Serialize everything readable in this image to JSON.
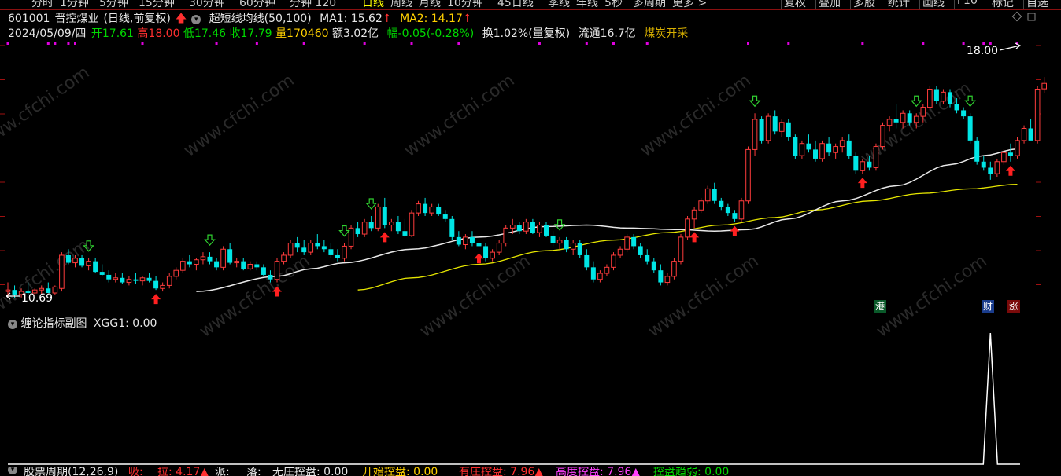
{
  "toolbar": {
    "periods": [
      {
        "label": "分时",
        "active": false
      },
      {
        "label": "1分钟",
        "active": false
      },
      {
        "label": "5分钟",
        "active": false
      },
      {
        "label": "15分钟",
        "active": false
      },
      {
        "label": "30分钟",
        "active": false
      },
      {
        "label": "60分钟",
        "active": false
      },
      {
        "label": "分钟 120",
        "active": false
      },
      {
        "label": "日线",
        "active": true
      },
      {
        "label": "周线",
        "active": false
      },
      {
        "label": "月线",
        "active": false
      },
      {
        "label": "10分钟",
        "active": false
      },
      {
        "label": "45日线",
        "active": false
      },
      {
        "label": "季线",
        "active": false
      },
      {
        "label": "年线",
        "active": false
      },
      {
        "label": "5秒",
        "active": false
      },
      {
        "label": "多周期",
        "active": false
      },
      {
        "label": "更多 >",
        "active": false
      }
    ],
    "right_menu": [
      "复权",
      "叠加",
      "多股",
      "统计",
      "画线",
      "F10",
      "标记",
      "自选"
    ]
  },
  "header": {
    "code": "601001",
    "name": "晋控煤业",
    "mode": "(日线,前复权)",
    "indicator": "超短线均线(50,100)",
    "ma1_label": "MA1: 15.62",
    "ma2_label": "MA2: 14.17",
    "date": "2024/05/09/四",
    "open": "开17.61",
    "high": "高18.00",
    "low": "低17.46",
    "close": "收17.79",
    "volume": "量170460",
    "amount": "额3.02亿",
    "change": "幅-0.05(-0.28%)",
    "turnover": "换1.02%(量复权)",
    "float": "流通16.7亿",
    "sector": "煤炭开采"
  },
  "price_labels": {
    "high_mark": "18.00",
    "low_mark": "10.69"
  },
  "event_tags": {
    "gang": "港",
    "cai": "财",
    "zhang": "涨"
  },
  "subchart": {
    "title": "缠论指标副图",
    "xgg1_label": "XGG1: 0.00"
  },
  "bottom": {
    "period_label": "股票周期(12,26,9)",
    "x": "吸:",
    "la": "拉: 4.17▲",
    "pai": "派:",
    "luo": "落:",
    "no_control": "无庄控盘: 0.00",
    "start_control": "开始控盘: 0.00",
    "has_control": "有庄控盘: 7.96▲",
    "high_control": "高度控盘: 7.96▲",
    "weak_control": "控盘趋弱: 0.00"
  },
  "watermark": "www.cfchi.com",
  "colors": {
    "up": "#ff3c3c",
    "down": "#00e6e6",
    "ma1": "#e8e8e8",
    "ma2": "#e6e600",
    "signal_up": "#ff2020",
    "signal_down": "#30d030",
    "background": "#000000"
  },
  "chart_data": {
    "type": "candlestick",
    "y_range": [
      10.2,
      19.2
    ],
    "ohlc": [
      [
        10.9,
        11.2,
        10.7,
        10.95
      ],
      [
        10.95,
        11.1,
        10.69,
        10.8
      ],
      [
        10.8,
        11.0,
        10.7,
        10.9
      ],
      [
        10.9,
        11.2,
        10.8,
        10.85
      ],
      [
        10.85,
        11.0,
        10.75,
        10.95
      ],
      [
        10.95,
        11.1,
        10.8,
        11.0
      ],
      [
        11.0,
        11.2,
        10.9,
        10.85
      ],
      [
        10.85,
        11.1,
        10.8,
        11.05
      ],
      [
        11.0,
        12.2,
        10.9,
        12.1
      ],
      [
        12.1,
        12.3,
        11.8,
        11.85
      ],
      [
        11.85,
        12.1,
        11.7,
        12.0
      ],
      [
        12.0,
        12.1,
        11.7,
        11.75
      ],
      [
        11.75,
        12.0,
        11.6,
        11.9
      ],
      [
        11.9,
        12.0,
        11.5,
        11.55
      ],
      [
        11.55,
        11.8,
        11.4,
        11.45
      ],
      [
        11.45,
        11.6,
        11.2,
        11.3
      ],
      [
        11.3,
        11.5,
        11.2,
        11.35
      ],
      [
        11.35,
        11.5,
        11.15,
        11.2
      ],
      [
        11.2,
        11.4,
        11.1,
        11.3
      ],
      [
        11.3,
        11.5,
        11.15,
        11.25
      ],
      [
        11.25,
        11.4,
        11.1,
        11.35
      ],
      [
        11.35,
        11.5,
        11.2,
        11.25
      ],
      [
        11.25,
        11.4,
        10.95,
        11.0
      ],
      [
        11.0,
        11.2,
        10.9,
        11.1
      ],
      [
        11.1,
        11.5,
        11.0,
        11.4
      ],
      [
        11.4,
        11.7,
        11.3,
        11.6
      ],
      [
        11.6,
        12.0,
        11.5,
        11.9
      ],
      [
        11.9,
        12.1,
        11.7,
        11.8
      ],
      [
        11.8,
        12.0,
        11.6,
        11.95
      ],
      [
        11.95,
        12.2,
        11.8,
        12.05
      ],
      [
        12.05,
        12.2,
        11.8,
        11.9
      ],
      [
        11.9,
        12.0,
        11.6,
        11.7
      ],
      [
        11.7,
        12.4,
        11.6,
        12.3
      ],
      [
        12.3,
        12.5,
        11.8,
        11.85
      ],
      [
        11.85,
        12.0,
        11.7,
        11.9
      ],
      [
        11.9,
        12.0,
        11.6,
        11.65
      ],
      [
        11.65,
        11.9,
        11.6,
        11.8
      ],
      [
        11.8,
        11.9,
        11.6,
        11.7
      ],
      [
        11.7,
        11.8,
        11.4,
        11.45
      ],
      [
        11.45,
        11.6,
        11.2,
        11.3
      ],
      [
        11.3,
        12.0,
        11.2,
        11.9
      ],
      [
        11.9,
        12.2,
        11.8,
        12.1
      ],
      [
        12.1,
        12.6,
        12.0,
        12.5
      ],
      [
        12.5,
        12.7,
        12.2,
        12.35
      ],
      [
        12.35,
        12.6,
        12.1,
        12.2
      ],
      [
        12.2,
        12.6,
        12.1,
        12.5
      ],
      [
        12.5,
        12.8,
        12.3,
        12.4
      ],
      [
        12.4,
        12.6,
        12.2,
        12.3
      ],
      [
        12.3,
        12.5,
        12.0,
        12.1
      ],
      [
        12.1,
        12.3,
        11.9,
        12.0
      ],
      [
        12.0,
        12.5,
        11.9,
        12.4
      ],
      [
        12.4,
        13.1,
        12.3,
        13.0
      ],
      [
        13.0,
        13.2,
        12.7,
        12.8
      ],
      [
        12.8,
        13.3,
        12.7,
        13.2
      ],
      [
        13.2,
        13.4,
        12.9,
        13.0
      ],
      [
        13.0,
        13.8,
        12.9,
        13.7
      ],
      [
        13.7,
        14.0,
        13.0,
        13.1
      ],
      [
        13.1,
        13.3,
        12.9,
        13.2
      ],
      [
        13.2,
        13.4,
        12.8,
        12.9
      ],
      [
        12.9,
        13.3,
        12.7,
        12.75
      ],
      [
        12.75,
        13.6,
        12.7,
        13.5
      ],
      [
        13.5,
        13.9,
        13.4,
        13.8
      ],
      [
        13.8,
        14.0,
        13.4,
        13.5
      ],
      [
        13.5,
        13.8,
        13.4,
        13.7
      ],
      [
        13.7,
        13.8,
        13.4,
        13.45
      ],
      [
        13.45,
        13.6,
        13.2,
        13.3
      ],
      [
        13.3,
        13.4,
        12.6,
        12.7
      ],
      [
        12.7,
        12.9,
        12.4,
        12.45
      ],
      [
        12.45,
        12.8,
        12.3,
        12.7
      ],
      [
        12.7,
        12.9,
        12.4,
        12.5
      ],
      [
        12.5,
        12.7,
        12.3,
        12.4
      ],
      [
        12.4,
        12.5,
        11.9,
        12.0
      ],
      [
        12.0,
        12.3,
        11.9,
        12.2
      ],
      [
        12.2,
        12.6,
        12.1,
        12.5
      ],
      [
        12.5,
        13.1,
        12.4,
        13.0
      ],
      [
        13.0,
        13.3,
        12.8,
        13.1
      ],
      [
        13.1,
        13.2,
        12.8,
        12.9
      ],
      [
        12.9,
        13.3,
        12.8,
        13.2
      ],
      [
        13.2,
        13.3,
        12.8,
        12.85
      ],
      [
        12.85,
        13.2,
        12.7,
        13.1
      ],
      [
        13.1,
        13.2,
        12.7,
        12.75
      ],
      [
        12.75,
        12.9,
        12.4,
        12.5
      ],
      [
        12.5,
        12.7,
        12.3,
        12.6
      ],
      [
        12.6,
        12.7,
        12.2,
        12.3
      ],
      [
        12.3,
        12.6,
        12.1,
        12.5
      ],
      [
        12.5,
        12.6,
        12.0,
        12.1
      ],
      [
        12.1,
        12.3,
        11.6,
        11.7
      ],
      [
        11.7,
        11.9,
        11.2,
        11.3
      ],
      [
        11.3,
        11.6,
        11.2,
        11.5
      ],
      [
        11.5,
        11.8,
        11.4,
        11.7
      ],
      [
        11.7,
        12.2,
        11.6,
        12.1
      ],
      [
        12.1,
        12.4,
        12.0,
        12.3
      ],
      [
        12.3,
        12.8,
        12.2,
        12.7
      ],
      [
        12.7,
        12.8,
        12.3,
        12.4
      ],
      [
        12.4,
        12.5,
        12.0,
        12.1
      ],
      [
        12.1,
        12.3,
        11.8,
        11.9
      ],
      [
        11.9,
        12.0,
        11.5,
        11.6
      ],
      [
        11.6,
        11.8,
        11.1,
        11.2
      ],
      [
        11.2,
        11.5,
        11.1,
        11.4
      ],
      [
        11.4,
        12.0,
        11.3,
        11.9
      ],
      [
        11.9,
        12.8,
        11.8,
        12.7
      ],
      [
        12.7,
        13.4,
        12.6,
        13.3
      ],
      [
        13.3,
        13.7,
        13.0,
        13.6
      ],
      [
        13.6,
        14.0,
        13.5,
        13.9
      ],
      [
        13.9,
        14.4,
        13.8,
        14.3
      ],
      [
        14.3,
        14.5,
        13.8,
        13.9
      ],
      [
        13.9,
        14.0,
        13.6,
        13.7
      ],
      [
        13.7,
        13.8,
        13.4,
        13.5
      ],
      [
        13.5,
        13.6,
        13.2,
        13.3
      ],
      [
        13.3,
        14.0,
        13.2,
        13.9
      ],
      [
        13.9,
        15.7,
        13.8,
        15.6
      ],
      [
        15.6,
        16.8,
        15.4,
        16.6
      ],
      [
        16.6,
        16.7,
        15.8,
        15.9
      ],
      [
        15.9,
        16.8,
        15.8,
        16.7
      ],
      [
        16.7,
        16.9,
        16.1,
        16.2
      ],
      [
        16.2,
        16.6,
        16.0,
        16.5
      ],
      [
        16.5,
        16.6,
        15.9,
        16.0
      ],
      [
        16.0,
        16.1,
        15.3,
        15.4
      ],
      [
        15.4,
        15.9,
        15.3,
        15.8
      ],
      [
        15.8,
        16.1,
        15.5,
        15.6
      ],
      [
        15.6,
        15.9,
        15.2,
        15.3
      ],
      [
        15.3,
        15.9,
        15.2,
        15.8
      ],
      [
        15.8,
        16.0,
        15.4,
        15.5
      ],
      [
        15.5,
        15.8,
        15.3,
        15.7
      ],
      [
        15.7,
        16.0,
        15.5,
        15.9
      ],
      [
        15.9,
        16.1,
        15.3,
        15.4
      ],
      [
        15.4,
        15.5,
        14.8,
        14.9
      ],
      [
        14.9,
        15.3,
        14.8,
        15.2
      ],
      [
        15.2,
        15.4,
        14.9,
        15.0
      ],
      [
        15.0,
        15.8,
        14.9,
        15.7
      ],
      [
        15.7,
        16.5,
        15.6,
        16.4
      ],
      [
        16.4,
        16.7,
        16.2,
        16.6
      ],
      [
        16.6,
        17.1,
        16.3,
        16.5
      ],
      [
        16.5,
        16.9,
        16.3,
        16.8
      ],
      [
        16.8,
        16.9,
        16.4,
        16.5
      ],
      [
        16.5,
        16.8,
        16.3,
        16.7
      ],
      [
        16.7,
        17.1,
        16.5,
        17.0
      ],
      [
        17.0,
        17.7,
        16.9,
        17.6
      ],
      [
        17.6,
        17.7,
        17.1,
        17.2
      ],
      [
        17.2,
        17.6,
        17.1,
        17.5
      ],
      [
        17.5,
        17.6,
        17.0,
        17.1
      ],
      [
        17.1,
        17.3,
        16.8,
        16.9
      ],
      [
        16.9,
        17.0,
        16.6,
        16.7
      ],
      [
        16.7,
        16.8,
        15.8,
        15.9
      ],
      [
        15.9,
        16.0,
        15.1,
        15.2
      ],
      [
        15.2,
        15.4,
        14.9,
        15.0
      ],
      [
        15.0,
        15.2,
        14.6,
        14.8
      ],
      [
        14.8,
        15.3,
        14.7,
        15.2
      ],
      [
        15.2,
        15.6,
        15.1,
        15.5
      ],
      [
        15.5,
        15.8,
        15.2,
        15.4
      ],
      [
        15.4,
        16.0,
        15.3,
        15.9
      ],
      [
        15.9,
        16.4,
        15.8,
        16.3
      ],
      [
        16.3,
        16.6,
        16.1,
        15.9
      ],
      [
        15.9,
        17.7,
        15.8,
        17.6
      ],
      [
        17.61,
        18.0,
        17.46,
        17.79
      ]
    ],
    "ma1_key": [
      [
        5,
        15.6
      ],
      [
        40,
        13.6
      ],
      [
        70,
        12.8
      ],
      [
        90,
        12.5
      ],
      [
        105,
        12.6
      ],
      [
        120,
        12.8
      ],
      [
        140,
        14.5
      ],
      [
        150,
        15.62
      ]
    ],
    "ma2_key": [
      [
        0,
        12.3
      ],
      [
        50,
        13.1
      ],
      [
        80,
        13.9
      ],
      [
        100,
        14.2
      ],
      [
        120,
        14.6
      ],
      [
        143,
        14.85
      ],
      [
        150,
        15.0
      ]
    ],
    "up_signals": [
      22,
      40,
      56,
      70,
      102,
      108,
      127,
      149
    ],
    "down_signals": [
      12,
      30,
      50,
      54,
      82,
      111,
      135,
      143
    ],
    "subchart_peak": {
      "index": 146,
      "value": 1.0
    }
  }
}
